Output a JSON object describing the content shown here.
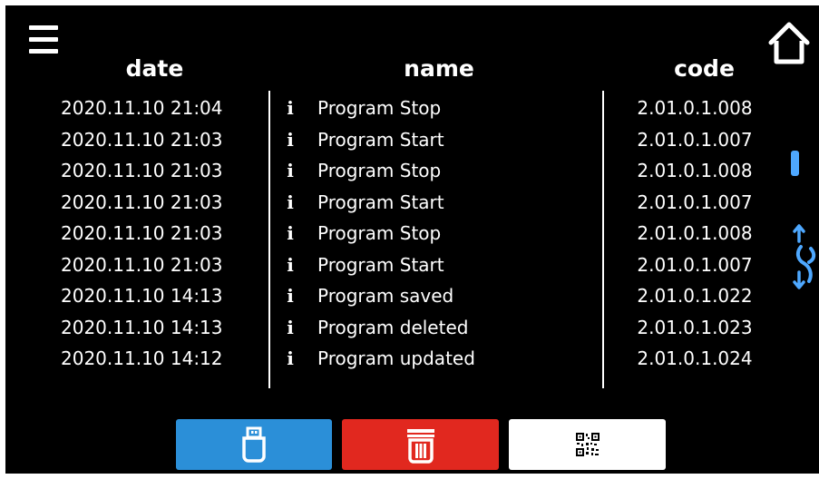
{
  "header": {
    "menu_icon": "hamburger-menu-icon",
    "home_icon": "home-icon"
  },
  "columns": {
    "date": "date",
    "name": "name",
    "code": "code"
  },
  "rows": [
    {
      "date": "2020.11.10  21:04",
      "icon": "i",
      "name": "Program Stop",
      "code": "2.01.0.1.008"
    },
    {
      "date": "2020.11.10  21:03",
      "icon": "i",
      "name": "Program Start",
      "code": "2.01.0.1.007"
    },
    {
      "date": "2020.11.10  21:03",
      "icon": "i",
      "name": "Program Stop",
      "code": "2.01.0.1.008"
    },
    {
      "date": "2020.11.10  21:03",
      "icon": "i",
      "name": "Program Start",
      "code": "2.01.0.1.007"
    },
    {
      "date": "2020.11.10  21:03",
      "icon": "i",
      "name": "Program Stop",
      "code": "2.01.0.1.008"
    },
    {
      "date": "2020.11.10  21:03",
      "icon": "i",
      "name": "Program Start",
      "code": "2.01.0.1.007"
    },
    {
      "date": "2020.11.10  14:13",
      "icon": "i",
      "name": "Program saved",
      "code": "2.01.0.1.022"
    },
    {
      "date": "2020.11.10  14:13",
      "icon": "i",
      "name": "Program deleted",
      "code": "2.01.0.1.023"
    },
    {
      "date": "2020.11.10  14:12",
      "icon": "i",
      "name": "Program updated",
      "code": "2.01.0.1.024"
    }
  ],
  "scrollbar": {
    "thumb_color": "#4ea8ff",
    "scroll_icon": "scroll-updown-icon"
  },
  "buttons": {
    "usb": {
      "icon": "usb-drive-icon",
      "color": "#2b8fd8"
    },
    "delete": {
      "icon": "trash-icon",
      "color": "#e1281f"
    },
    "qr": {
      "icon": "qr-code-icon",
      "color": "#ffffff"
    }
  },
  "colors": {
    "background": "#000000",
    "text": "#ffffff"
  }
}
